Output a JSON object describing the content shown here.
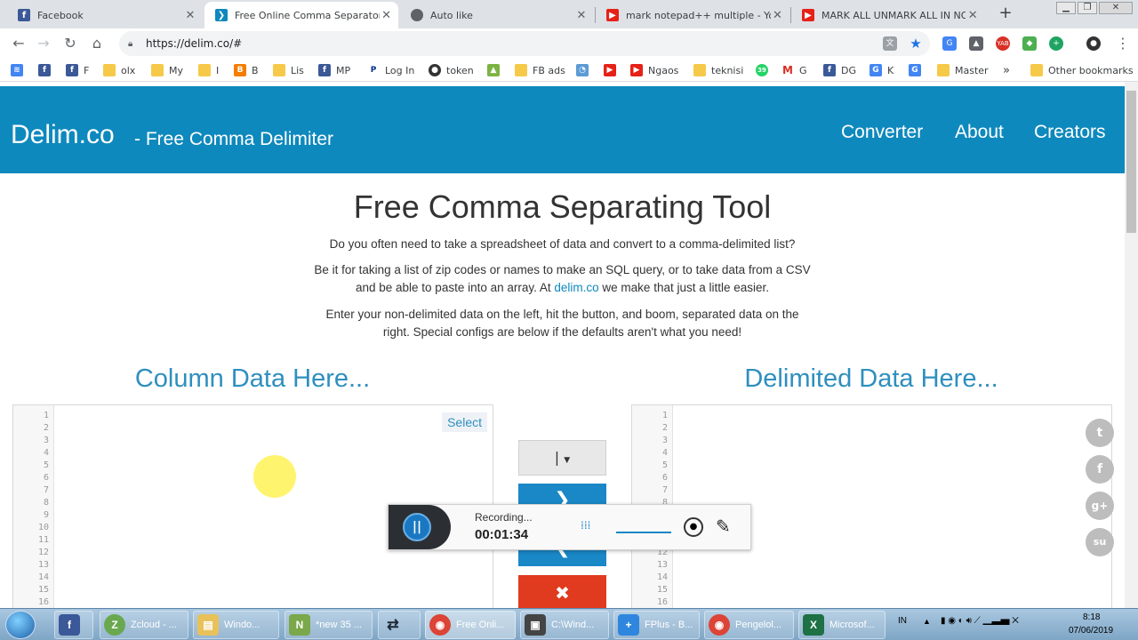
{
  "browser": {
    "tabs": [
      {
        "title": "Facebook",
        "icon": "facebook-icon",
        "color": "#3b5998",
        "glyph": "f"
      },
      {
        "title": "Free Online Comma Separator T",
        "icon": "delim-icon",
        "color": "#0e89bd",
        "glyph": "❯"
      },
      {
        "title": "Auto like",
        "icon": "globe-icon",
        "color": "#5f6368",
        "glyph": "●"
      },
      {
        "title": "mark notepad++ multiple - You",
        "icon": "youtube-icon",
        "color": "#e62117",
        "glyph": "▶"
      },
      {
        "title": "MARK ALL UNMARK ALL IN NO",
        "icon": "youtube-icon",
        "color": "#e62117",
        "glyph": "▶"
      }
    ],
    "url": "https://delim.co/#",
    "bookmarks": [
      {
        "label": "",
        "icon": "apps-icon",
        "color": "#4285f4"
      },
      {
        "label": "",
        "icon": "facebook-icon",
        "color": "#3b5998"
      },
      {
        "label": "F",
        "icon": "facebook-icon",
        "color": "#3b5998"
      },
      {
        "label": "olx",
        "icon": "folder-icon",
        "color": "#f7c948"
      },
      {
        "label": "My",
        "icon": "folder-icon",
        "color": "#f7c948"
      },
      {
        "label": "I",
        "icon": "folder-icon",
        "color": "#f7c948"
      },
      {
        "label": "B",
        "icon": "blogger-icon",
        "color": "#f57d00"
      },
      {
        "label": "Lis",
        "icon": "folder-icon",
        "color": "#f7c948"
      },
      {
        "label": "MP",
        "icon": "facebook-icon",
        "color": "#3b5998"
      },
      {
        "label": "Log In",
        "icon": "paypal-icon",
        "color": "#003087"
      },
      {
        "label": "token",
        "icon": "github-icon",
        "color": "#333333"
      },
      {
        "label": "",
        "icon": "android-icon",
        "color": "#7cb342"
      },
      {
        "label": "FB ads",
        "icon": "folder-icon",
        "color": "#f7c948"
      },
      {
        "label": "",
        "icon": "rss-icon",
        "color": "#5b9bd5"
      },
      {
        "label": "",
        "icon": "youtube-icon",
        "color": "#e62117"
      },
      {
        "label": "Ngaos",
        "icon": "youtube-icon",
        "color": "#e62117"
      },
      {
        "label": "teknisi",
        "icon": "folder-icon",
        "color": "#f7c948"
      },
      {
        "label": "",
        "icon": "wa-icon",
        "color": "#25d366"
      },
      {
        "label": "G",
        "icon": "gmail-icon",
        "color": "#d93025"
      },
      {
        "label": "DG",
        "icon": "facebook-icon",
        "color": "#3b5998"
      },
      {
        "label": "K",
        "icon": "translate-icon",
        "color": "#4285f4"
      },
      {
        "label": "",
        "icon": "translate-icon",
        "color": "#4285f4"
      },
      {
        "label": "Master",
        "icon": "folder-icon",
        "color": "#f7c948"
      }
    ],
    "bookmarks_more": "»",
    "other_bookmarks": "Other bookmarks"
  },
  "site": {
    "logo": "Delim.co",
    "tagline": "- Free Comma Delimiter",
    "nav": [
      "Converter",
      "About",
      "Creators"
    ],
    "heading": "Free Comma Separating Tool",
    "intro1": "Do you often need to take a spreadsheet of data and convert to a comma-delimited list?",
    "intro2a": "Be it for taking a list of zip codes or names to make an SQL query, or to take data from a CSV",
    "intro2b_pre": "and be able to paste into an array. At ",
    "intro2b_link": "delim.co",
    "intro2b_post": " we make that just a little easier.",
    "intro3a": "Enter your non-delimited data on the left, hit the button, and boom, separated data on the",
    "intro3b": "right. Special configs are below if the defaults aren't what you need!",
    "left_title": "Column Data Here...",
    "right_title": "Delimited Data Here...",
    "select_label": "Select",
    "delimiter_value": "|",
    "line_numbers": [
      1,
      2,
      3,
      4,
      5,
      6,
      7,
      8,
      9,
      10,
      11,
      12,
      13,
      14,
      15,
      16
    ],
    "social": [
      {
        "icon": "twitter-icon",
        "glyph": "t"
      },
      {
        "icon": "facebook-icon",
        "glyph": "f"
      },
      {
        "icon": "googleplus-icon",
        "glyph": "g+"
      },
      {
        "icon": "stumbleupon-icon",
        "glyph": "su"
      }
    ]
  },
  "recorder": {
    "status": "Recording...",
    "time": "00:01:34"
  },
  "taskbar": {
    "items": [
      {
        "label": "",
        "icon": "facebook-icon",
        "color": "#3b5998",
        "glyph": "f"
      },
      {
        "label": "Zcloud - ...",
        "icon": "zcloud-icon",
        "color": "#6aa84f",
        "glyph": "Z"
      },
      {
        "label": "Windo...",
        "icon": "explorer-icon",
        "color": "#e8c15a",
        "glyph": "▤"
      },
      {
        "label": "*new 35 ...",
        "icon": "notepadpp-icon",
        "color": "#7aa84a",
        "glyph": "N"
      },
      {
        "label": "",
        "icon": "shuffle-icon",
        "color": "#34495e",
        "glyph": "⇄"
      },
      {
        "label": "Free Onli...",
        "icon": "chrome-icon",
        "color": "#db4437",
        "glyph": "◉"
      },
      {
        "label": "C:\\Wind...",
        "icon": "cmd-icon",
        "color": "#444444",
        "glyph": "▣"
      },
      {
        "label": "FPlus - B...",
        "icon": "fplus-icon",
        "color": "#2e86de",
        "glyph": "+"
      },
      {
        "label": "Pengelol...",
        "icon": "chrome-icon",
        "color": "#db4437",
        "glyph": "◉"
      },
      {
        "label": "Microsof...",
        "icon": "excel-icon",
        "color": "#1e7145",
        "glyph": "X"
      }
    ],
    "lang": "IN",
    "time": "8:18",
    "date": "07/06/2019"
  }
}
